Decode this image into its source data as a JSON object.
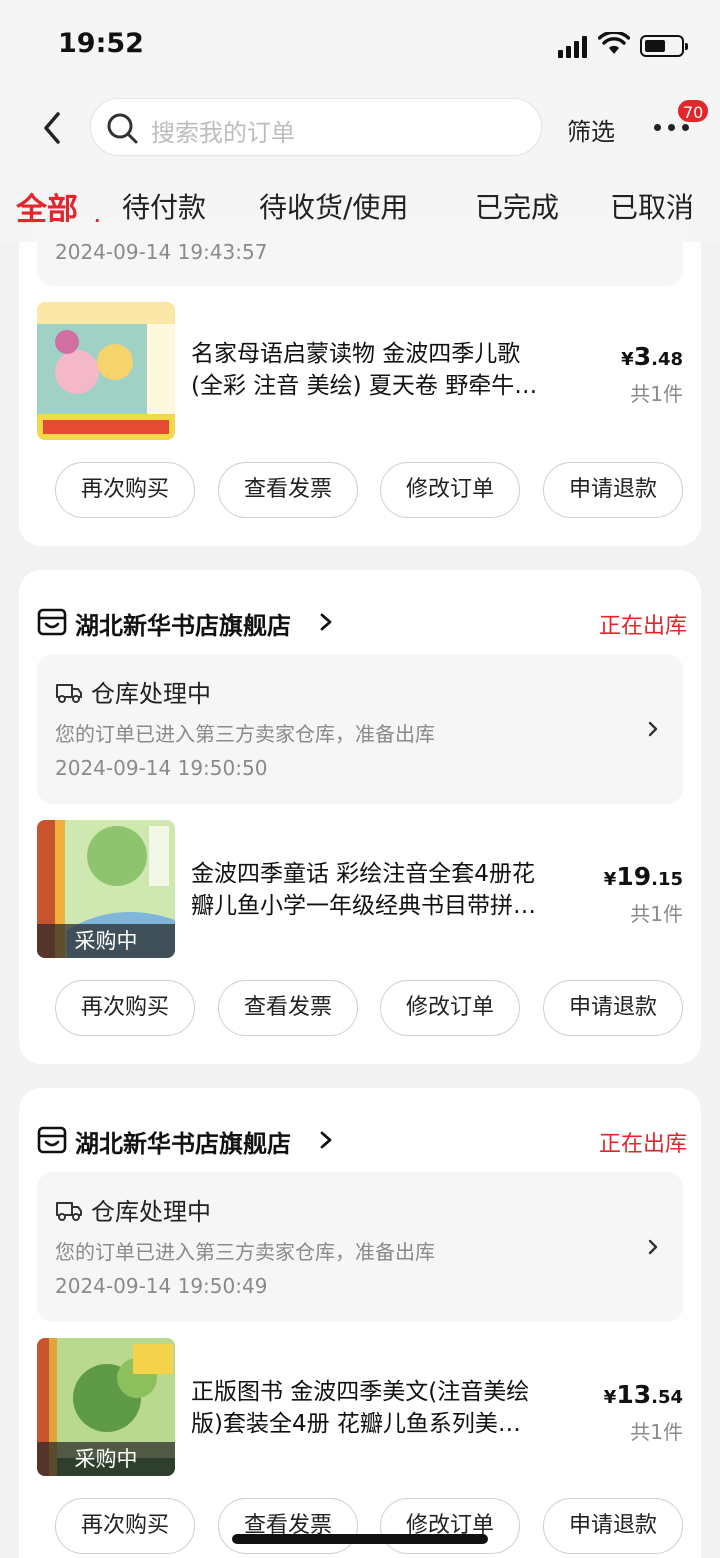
{
  "status_bar": {
    "time": "19:52"
  },
  "header": {
    "search_placeholder": "搜索我的订单",
    "filter_label": "筛选",
    "badge_count": "70"
  },
  "tabs": [
    "全部",
    "待付款",
    "待收货/使用",
    "已完成",
    "已取消"
  ],
  "orders": [
    {
      "partial_time": "2024-09-14 19:43:57",
      "product": {
        "title_line1": "名家母语启蒙读物 金波四季儿歌",
        "title_line2": "(全彩 注音 美绘) 夏天卷 野牵牛…",
        "price_symbol": "¥",
        "price_int": "3",
        "price_dec": ".48",
        "qty": "共1件",
        "thumb_tag": ""
      },
      "buttons": [
        "再次购买",
        "查看发票",
        "修改订单",
        "申请退款"
      ]
    },
    {
      "store": "湖北新华书店旗舰店",
      "status": "正在出库",
      "track_title": "仓库处理中",
      "track_desc": "您的订单已进入第三方卖家仓库，准备出库",
      "track_time": "2024-09-14 19:50:50",
      "product": {
        "title_line1": "金波四季童话 彩绘注音全套4册花",
        "title_line2": "瓣儿鱼小学一年级经典书目带拼…",
        "price_symbol": "¥",
        "price_int": "19",
        "price_dec": ".15",
        "qty": "共1件",
        "thumb_tag": "采购中"
      },
      "buttons": [
        "再次购买",
        "查看发票",
        "修改订单",
        "申请退款"
      ]
    },
    {
      "store": "湖北新华书店旗舰店",
      "status": "正在出库",
      "track_title": "仓库处理中",
      "track_desc": "您的订单已进入第三方卖家仓库，准备出库",
      "track_time": "2024-09-14 19:50:49",
      "product": {
        "title_line1": "正版图书 金波四季美文(注音美绘",
        "title_line2": "版)套装全4册 花瓣儿鱼系列美…",
        "price_symbol": "¥",
        "price_int": "13",
        "price_dec": ".54",
        "qty": "共1件",
        "thumb_tag": "采购中"
      },
      "buttons": [
        "再次购买",
        "查看发票",
        "修改订单",
        "申请退款"
      ]
    }
  ],
  "colors": {
    "accent": "#e3252c",
    "background": "#f2f2f2",
    "card": "#ffffff",
    "muted": "#8a8a8a"
  }
}
